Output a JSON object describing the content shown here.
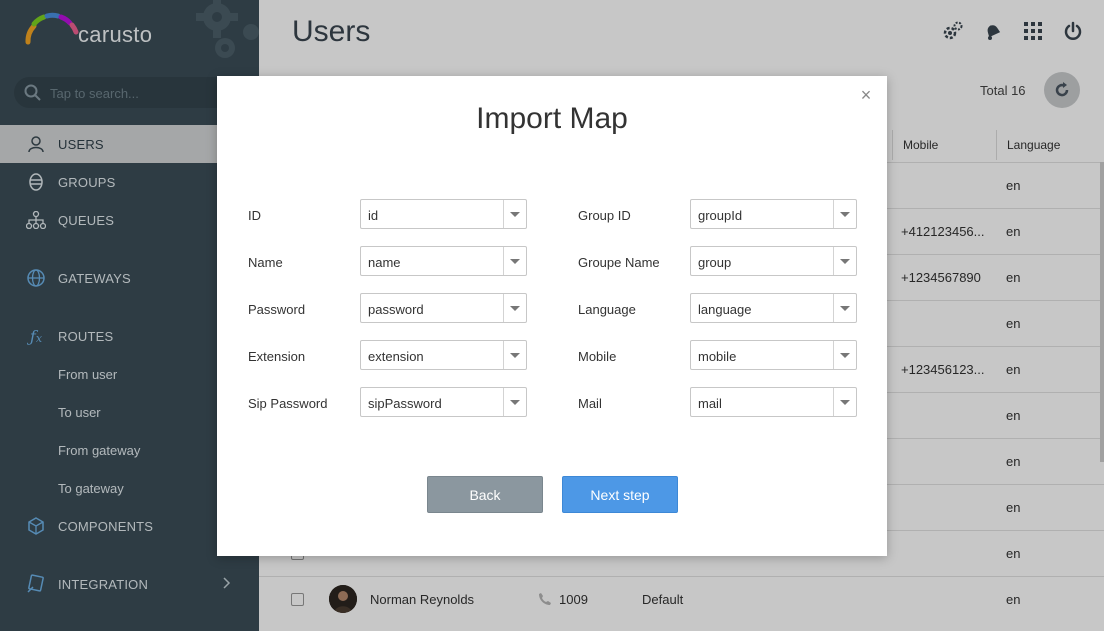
{
  "app": {
    "logo_text": "carusto",
    "search_placeholder": "Tap to search..."
  },
  "sidebar": {
    "items": [
      {
        "label": "USERS",
        "icon": "user-icon"
      },
      {
        "label": "GROUPS",
        "icon": "groups-icon"
      },
      {
        "label": "QUEUES",
        "icon": "queues-icon"
      },
      {
        "label": "GATEWAYS",
        "icon": "globe-icon"
      },
      {
        "label": "ROUTES",
        "icon": "fx-icon"
      },
      {
        "label": "COMPONENTS",
        "icon": "cube-icon"
      },
      {
        "label": "INTEGRATION",
        "icon": "integration-icon"
      }
    ],
    "route_sub_items": [
      "From user",
      "To user",
      "From gateway",
      "To gateway"
    ]
  },
  "main": {
    "title": "Users",
    "total": "Total 16",
    "columns": {
      "mobile": "Mobile",
      "language": "Language"
    },
    "rows": [
      {
        "mobile": "",
        "language": "en"
      },
      {
        "mobile": "+412123456...",
        "language": "en"
      },
      {
        "mobile": "+1234567890",
        "language": "en"
      },
      {
        "mobile": "",
        "language": "en"
      },
      {
        "mobile": "+123456123...",
        "language": "en"
      },
      {
        "mobile": "",
        "language": "en"
      },
      {
        "mobile": "",
        "language": "en"
      },
      {
        "mobile": "",
        "language": "en"
      },
      {
        "mobile": "",
        "language": "en"
      }
    ],
    "last_row": {
      "name": "Norman Reynolds",
      "extension": "1009",
      "group": "Default",
      "language": "en"
    }
  },
  "modal": {
    "title": "Import Map",
    "close": "×",
    "left_fields": [
      {
        "label": "ID",
        "value": "id"
      },
      {
        "label": "Name",
        "value": "name"
      },
      {
        "label": "Password",
        "value": "password"
      },
      {
        "label": "Extension",
        "value": "extension"
      },
      {
        "label": "Sip Password",
        "value": "sipPassword"
      }
    ],
    "right_fields": [
      {
        "label": "Group ID",
        "value": "groupId"
      },
      {
        "label": "Groupe Name",
        "value": "group"
      },
      {
        "label": "Language",
        "value": "language"
      },
      {
        "label": "Mobile",
        "value": "mobile"
      },
      {
        "label": "Mail",
        "value": "mail"
      }
    ],
    "back_label": "Back",
    "next_label": "Next step"
  }
}
